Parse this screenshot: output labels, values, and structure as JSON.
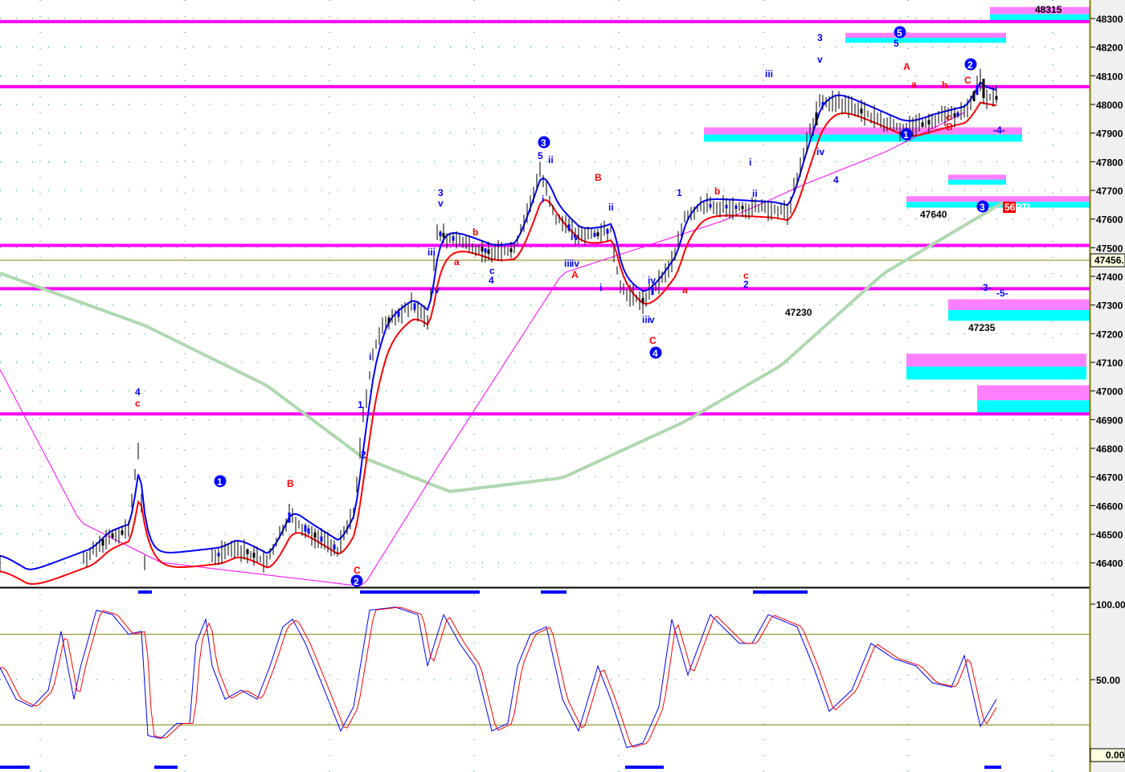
{
  "chart_data": [
    {
      "type": "line",
      "name": "price-panel",
      "ylim": [
        46320,
        48360
      ],
      "y_ticks": [
        "48300",
        "48200",
        "48100",
        "48000",
        "47900",
        "47800",
        "47700",
        "47600",
        "47500",
        "47400",
        "47300",
        "47200",
        "47100",
        "47000",
        "46900",
        "46800",
        "46700",
        "46600",
        "46500",
        "46400"
      ],
      "last_price_label": "47456.",
      "last_price": 47456,
      "close_series": {
        "x": [
          0,
          8,
          28,
          33,
          40,
          43,
          45,
          68,
          73,
          83,
          90,
          95,
          105,
          110,
          113,
          116,
          120,
          128,
          133,
          136,
          143,
          153,
          160,
          168,
          173,
          180,
          187,
          190,
          193,
          200,
          205,
          210,
          213,
          218,
          240,
          245,
          250,
          255,
          260,
          280,
          283,
          290,
          300,
          305,
          306,
          325,
          332,
          340,
          346,
          351,
          355,
          357,
          365,
          370,
          380,
          382,
          385,
          400,
          413,
          425,
          430,
          435,
          450,
          455,
          460,
          470,
          478,
          570
        ],
        "y": [
          46400,
          46345,
          46430,
          46490,
          46515,
          46795,
          46400,
          46430,
          46460,
          46400,
          46570,
          46515,
          46445,
          46570,
          46907,
          47130,
          47243,
          47300,
          47243,
          47550,
          47522,
          47480,
          47494,
          47760,
          47606,
          47536,
          47550,
          47564,
          47355,
          47313,
          47383,
          47467,
          47606,
          47648,
          47634,
          47620,
          47832,
          48000,
          48014,
          47916,
          47916,
          47944,
          47972,
          48084,
          48028,
          48000,
          48014,
          47944,
          47804,
          47690,
          47815,
          47815,
          47815,
          47815,
          47815,
          47815,
          47815,
          47815,
          47815,
          47815,
          47815,
          47815,
          47815,
          47815,
          47815,
          47815,
          47815,
          47815
        ]
      },
      "moving_average_slow": {
        "x": [
          0,
          45,
          83,
          113,
          140,
          175,
          213,
          243,
          275,
          313
        ],
        "y": [
          47411,
          47229,
          47019,
          46767,
          46649,
          46697,
          46893,
          47089,
          47411,
          47664
        ]
      },
      "moving_average_fast": {
        "x": [
          0,
          25,
          50,
          113,
          138,
          175,
          225,
          250,
          275,
          300
        ],
        "y": [
          47075,
          46542,
          46402,
          46318,
          46767,
          47411,
          47594,
          47720,
          47832,
          47972
        ]
      },
      "levels": [
        48289,
        48062,
        47508,
        47357,
        46920
      ],
      "zones": [
        {
          "x": [
            308,
            339
          ],
          "top": 48340,
          "bottom": 48290
        },
        {
          "x": [
            263,
            313
          ],
          "top": 48250,
          "bottom": 48215
        },
        {
          "x": [
            219,
            318
          ],
          "top": 47920,
          "bottom": 47870
        },
        {
          "x": [
            295,
            313
          ],
          "top": 47755,
          "bottom": 47720
        },
        {
          "x": [
            282,
            339
          ],
          "top": 47680,
          "bottom": 47640
        },
        {
          "x": [
            295,
            339
          ],
          "top": 47320,
          "bottom": 47245
        },
        {
          "x": [
            282,
            338
          ],
          "top": 47130,
          "bottom": 47040
        },
        {
          "x": [
            304,
            339
          ],
          "top": 47020,
          "bottom": 46915
        }
      ],
      "price_annotations": [
        "48315",
        "47640",
        "47230",
        "47235",
        "56PTI"
      ],
      "wave_labels": [
        "4",
        "c",
        "1",
        "B",
        "C",
        "2",
        "1",
        "2",
        "i",
        "3",
        "v",
        "iii",
        "iv",
        "a",
        "b",
        "c",
        "4",
        "3",
        "5",
        "ii",
        "i",
        "iii",
        "iv",
        "A",
        "B",
        "ii",
        "i",
        "iv",
        "iii",
        "v",
        "C",
        "4",
        "1",
        "iv",
        "a",
        "b",
        "c",
        "2",
        "iii",
        "i",
        "ii",
        "3",
        "v",
        "iv",
        "4",
        "5",
        "5",
        "1",
        "A",
        "a",
        "b",
        "c",
        "B",
        "2",
        "C",
        "3",
        "-3-",
        "-5-",
        "-4-"
      ]
    },
    {
      "type": "line",
      "name": "stochastic-panel",
      "ylim": [
        0,
        100
      ],
      "y_ticks": [
        "100.00",
        "50.00",
        "0.00"
      ],
      "reference_levels": [
        80,
        20
      ],
      "k_series": {
        "x": [
          0,
          5,
          10,
          15,
          19,
          23,
          25,
          30,
          35,
          40,
          44,
          46,
          50,
          55,
          59,
          61,
          64,
          66,
          70,
          75,
          80,
          84,
          88,
          91,
          95,
          100,
          106,
          110,
          115,
          123,
          130,
          133,
          138,
          143,
          148,
          153,
          158,
          161,
          165,
          170,
          175,
          180,
          186,
          190,
          195,
          200,
          205,
          209,
          214,
          221,
          230,
          234,
          239,
          248,
          253,
          258,
          265,
          271,
          278,
          285,
          290,
          296,
          300,
          305,
          310
        ],
        "y": [
          58,
          37,
          32,
          43,
          82,
          37,
          58,
          96,
          93,
          80,
          82,
          13,
          11,
          21,
          21,
          74,
          90,
          59,
          37,
          43,
          37,
          59,
          85,
          90,
          74,
          48,
          16,
          32,
          96,
          98,
          93,
          59,
          93,
          74,
          59,
          16,
          21,
          59,
          80,
          85,
          37,
          16,
          59,
          37,
          5,
          8,
          32,
          90,
          53,
          93,
          74,
          74,
          93,
          85,
          59,
          29,
          43,
          74,
          64,
          59,
          48,
          45,
          66,
          19,
          37
        ]
      },
      "d_lag_bars": 1.5
    }
  ]
}
